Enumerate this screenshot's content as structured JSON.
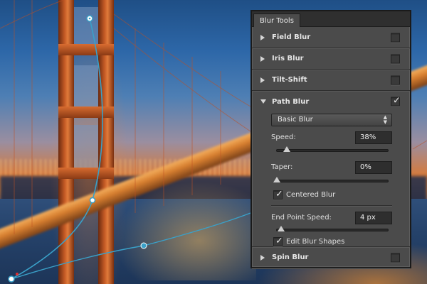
{
  "panel": {
    "tab_label": "Blur Tools",
    "sections": {
      "field_blur": {
        "title": "Field Blur",
        "enabled": false
      },
      "iris_blur": {
        "title": "Iris Blur",
        "enabled": false
      },
      "tilt_shift": {
        "title": "Tilt-Shift",
        "enabled": false
      },
      "path_blur": {
        "title": "Path Blur",
        "enabled": true,
        "mode": "Basic Blur",
        "speed_label": "Speed:",
        "speed_value": "38%",
        "speed_level": 0.09,
        "taper_label": "Taper:",
        "taper_value": "0%",
        "taper_level": 0.0,
        "centered_blur_label": "Centered Blur",
        "centered_blur": true,
        "end_point_speed_label": "End Point Speed:",
        "end_point_speed_value": "4 px",
        "end_point_speed_level": 0.04,
        "edit_blur_shapes_label": "Edit Blur Shapes",
        "edit_blur_shapes": true
      },
      "spin_blur": {
        "title": "Spin Blur",
        "enabled": false
      }
    }
  },
  "check_glyph": "✓",
  "colors": {
    "panel_bg": "#4b4b4b",
    "path_stroke": "#3aa0c8",
    "path_endpoint_red": "#e03030"
  }
}
